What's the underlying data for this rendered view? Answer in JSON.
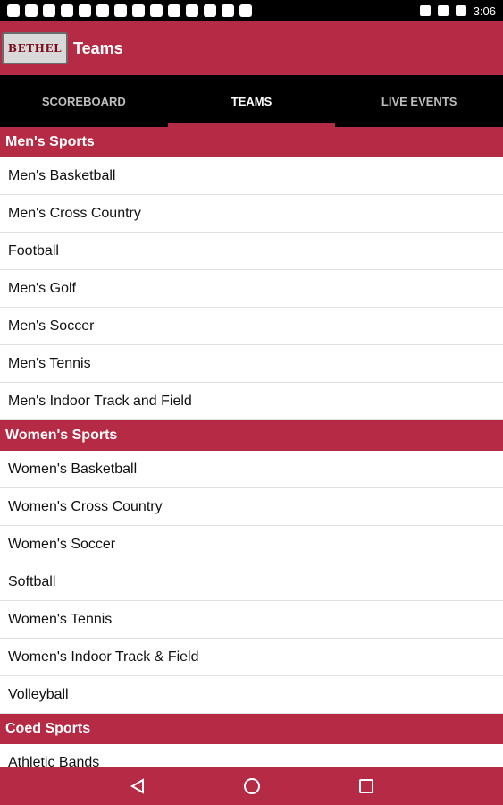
{
  "status_bar": {
    "time": "3:06"
  },
  "app_bar": {
    "logo_text": "BETHEL",
    "title": "Teams"
  },
  "tabs": [
    {
      "label": "SCOREBOARD",
      "active": false
    },
    {
      "label": "TEAMS",
      "active": true
    },
    {
      "label": "LIVE EVENTS",
      "active": false
    }
  ],
  "sections": [
    {
      "header": "Men's Sports",
      "items": [
        "Men's Basketball",
        "Men's Cross Country",
        "Football",
        "Men's Golf",
        "Men's Soccer",
        "Men's Tennis",
        "Men's Indoor Track and Field"
      ]
    },
    {
      "header": "Women's Sports",
      "items": [
        "Women's Basketball",
        "Women's Cross Country",
        "Women's Soccer",
        "Softball",
        "Women's Tennis",
        "Women's Indoor Track & Field",
        "Volleyball"
      ]
    },
    {
      "header": "Coed Sports",
      "items": [
        "Athletic Bands"
      ]
    }
  ],
  "nav_bar": {
    "back_icon": "back-triangle-icon",
    "home_icon": "home-circle-icon",
    "recents_icon": "recents-square-icon"
  },
  "colors": {
    "accent": "#b52a45"
  }
}
